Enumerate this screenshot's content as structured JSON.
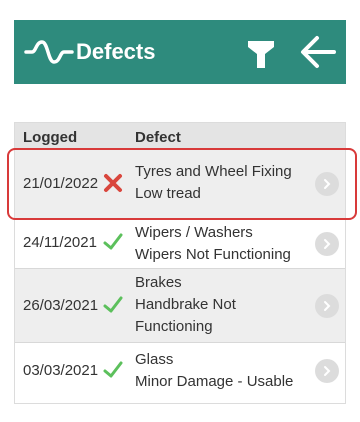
{
  "header": {
    "title": "Defects",
    "color": "#2e8b7d"
  },
  "table": {
    "col_logged": "Logged",
    "col_defect": "Defect",
    "rows": [
      {
        "date": "21/01/2022",
        "status": "x-icon",
        "line1": "Tyres and Wheel Fixing",
        "line2": "Low tread",
        "line3": ""
      },
      {
        "date": "24/11/2021",
        "status": "check-icon",
        "line1": "Wipers / Washers",
        "line2": "Wipers Not Functioning",
        "line3": ""
      },
      {
        "date": "26/03/2021",
        "status": "check-icon",
        "line1": "Brakes",
        "line2": "Handbrake Not",
        "line3": "Functioning"
      },
      {
        "date": "03/03/2021",
        "status": "check-icon",
        "line1": "Glass",
        "line2": "Minor Damage - Usable",
        "line3": ""
      }
    ]
  },
  "colors": {
    "highlight": "#d83a3a",
    "check": "#5cc05c",
    "cross": "#d9463d"
  }
}
